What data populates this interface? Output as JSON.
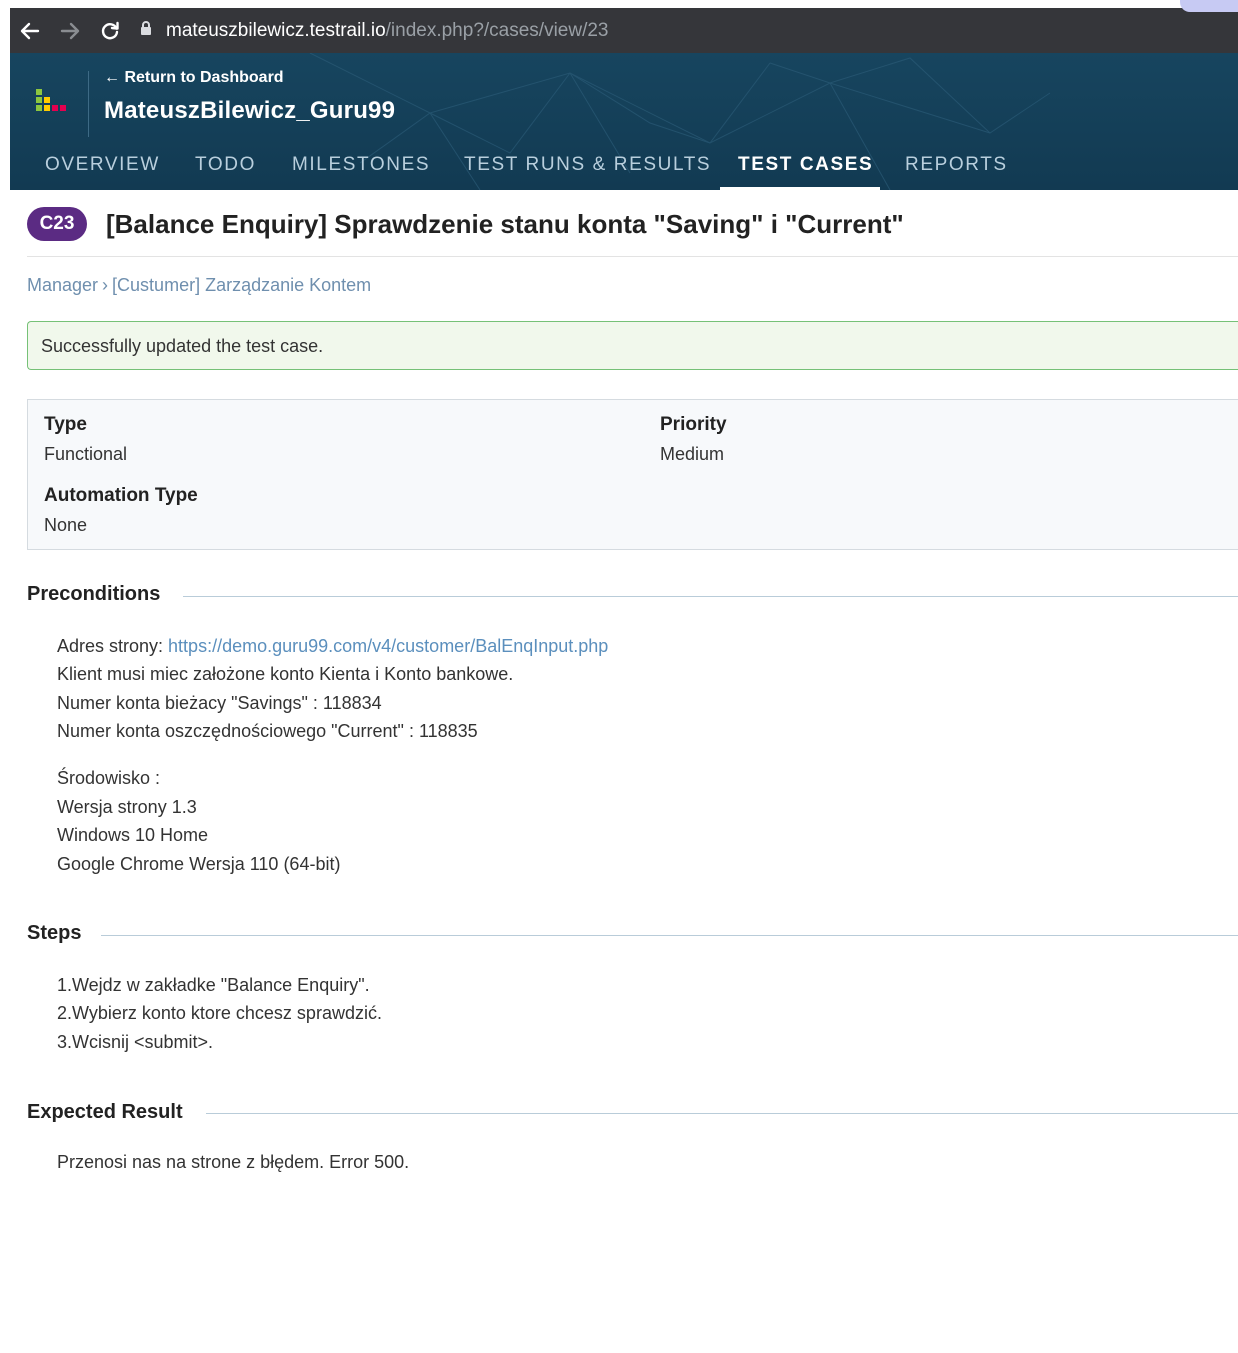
{
  "browser": {
    "url_host": "mateuszbilewicz.testrail.io",
    "url_path": "/index.php?/cases/view/23"
  },
  "header": {
    "return_label": "← Return to Dashboard",
    "project_name": "MateuszBilewicz_Guru99",
    "tabs": [
      {
        "label": "OVERVIEW"
      },
      {
        "label": "TODO"
      },
      {
        "label": "MILESTONES"
      },
      {
        "label": "TEST RUNS & RESULTS"
      },
      {
        "label": "TEST CASES",
        "active": true
      },
      {
        "label": "REPORTS"
      }
    ]
  },
  "case": {
    "id_badge": "C23",
    "title": "[Balance Enquiry] Sprawdzenie stanu konta \"Saving\" i \"Current\"",
    "breadcrumb": [
      "Manager",
      "[Custumer] Zarządzanie Kontem"
    ],
    "breadcrumb_sep": "›",
    "success_message": "Successfully updated the test case.",
    "fields": {
      "type_label": "Type",
      "type_value": "Functional",
      "priority_label": "Priority",
      "priority_value": "Medium",
      "automation_label": "Automation Type",
      "automation_value": "None"
    }
  },
  "preconditions": {
    "heading": "Preconditions",
    "address_prefix": "Adres strony: ",
    "address_link": "https://demo.guru99.com/v4/customer/BalEnqInput.php",
    "lines1": [
      "Klient musi miec założone konto Kienta i Konto bankowe.",
      "Numer konta bieżacy \"Savings\" : 118834",
      "Numer konta oszczędnościowego \"Current\" : 118835"
    ],
    "lines2": [
      "Środowisko :",
      "Wersja strony 1.3",
      "Windows 10 Home",
      "Google Chrome  Wersja 110 (64-bit)"
    ]
  },
  "steps": {
    "heading": "Steps",
    "lines": [
      "1.Wejdz w zakładke \"Balance Enquiry\".",
      "2.Wybierz konto ktore chcesz sprawdzić.",
      "3.Wcisnij <submit>."
    ]
  },
  "expected": {
    "heading": "Expected Result",
    "text": "Przenosi nas na strone z błędem. Error 500."
  },
  "colors": {
    "header_bg": "#123a52",
    "badge_bg": "#5b2b83",
    "link": "#5b8fbd",
    "success_border": "#76c177",
    "success_bg": "#f1f8ec"
  }
}
